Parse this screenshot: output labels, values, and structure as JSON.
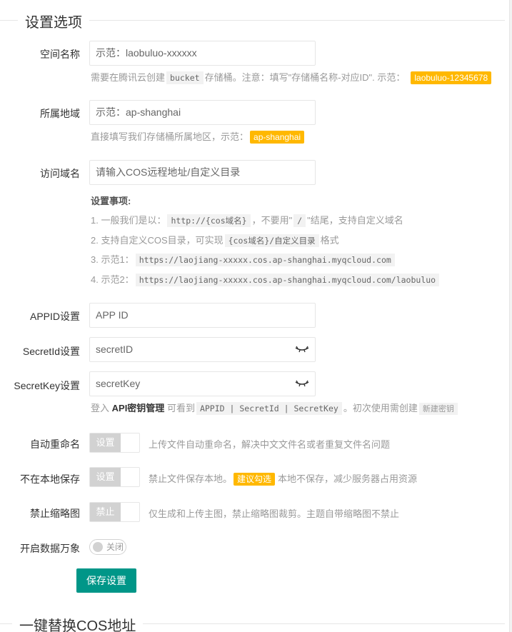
{
  "section1": {
    "title": "设置选项"
  },
  "section2": {
    "title": "一键替换COS地址"
  },
  "fields": {
    "bucket": {
      "label": "空间名称",
      "value": "示范：laobuluo-xxxxxx",
      "help_pre": "需要在腾讯云创建",
      "help_code": "bucket",
      "help_post": "存储桶。注意：填写\"存储桶名称-对应ID\". 示范：",
      "help_badge": "laobuluo-12345678"
    },
    "region": {
      "label": "所属地域",
      "value": "示范：ap-shanghai",
      "help_pre": "直接填写我们存储桶所属地区，示范：",
      "help_badge": "ap-shanghai"
    },
    "domain": {
      "label": "访问域名",
      "placeholder": "请输入COS远程地址/自定义目录",
      "notes_title": "设置事项:",
      "notes": [
        {
          "pre": "1. 一般我们是以：",
          "code": "http://{cos域名}",
          "mid": "，不要用\"",
          "code2": "/",
          "post": "\"结尾，支持自定义域名"
        },
        {
          "pre": "2. 支持自定义COS目录，可实现",
          "code": "{cos域名}/自定义目录",
          "post": "格式"
        },
        {
          "pre": "3. 示范1：",
          "code": "https://laojiang-xxxxx.cos.ap-shanghai.myqcloud.com"
        },
        {
          "pre": "4. 示范2：",
          "code": "https://laojiang-xxxxx.cos.ap-shanghai.myqcloud.com/laobuluo"
        }
      ]
    },
    "appid": {
      "label": "APPID设置",
      "placeholder": "APP ID"
    },
    "secretid": {
      "label": "SecretId设置",
      "placeholder": "secretID"
    },
    "secretkey": {
      "label": "SecretKey设置",
      "placeholder": "secretKey",
      "help_pre": "登入",
      "help_link": "API密钥管理",
      "help_mid": "可看到",
      "help_code": "APPID | SecretId | SecretKey",
      "help_mid2": "。初次使用需创建",
      "help_code2": "新建密钥"
    }
  },
  "switches": [
    {
      "label": "自动重命名",
      "state": "设置",
      "desc": "上传文件自动重命名，解决中文文件名或者重复文件名问题"
    },
    {
      "label": "不在本地保存",
      "state": "设置",
      "desc_pre": "禁止文件保存本地。",
      "badge": "建议勾选",
      "desc_post": "本地不保存，减少服务器占用资源"
    },
    {
      "label": "禁止缩略图",
      "state": "禁止",
      "desc": "仅生成和上传主图，禁止缩略图裁剪。主题自带缩略图不禁止"
    }
  ],
  "ci_toggle": {
    "label": "开启数据万象",
    "state": "关闭"
  },
  "save_button": "保存设置",
  "colors": {
    "primary": "#009688",
    "badge": "#ffb800",
    "switch_off": "#d2d2d2"
  }
}
